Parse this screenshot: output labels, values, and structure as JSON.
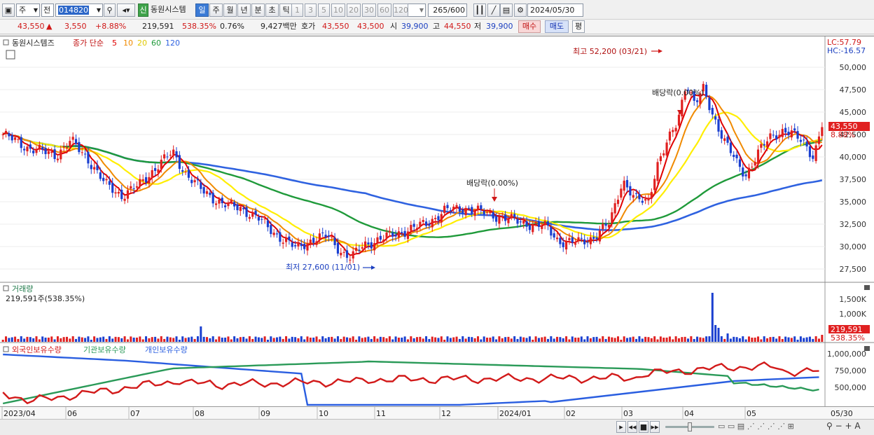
{
  "toolbar": {
    "type_label": "주",
    "prev_label": "전",
    "code": "014820",
    "badge": "신",
    "stock_name": "동원시스템",
    "periods": [
      "일",
      "주",
      "월",
      "년",
      "분",
      "초",
      "틱"
    ],
    "active_period": "일",
    "intervals": [
      "1",
      "3",
      "5",
      "10",
      "20",
      "30",
      "60",
      "120"
    ],
    "count": "265",
    "count_total": "/600",
    "date": "2024/05/30"
  },
  "quote": {
    "price": "43,550",
    "arrow": "▲",
    "change": "3,550",
    "change_pct": "+8.88%",
    "volume": "219,591",
    "volume_ratio": "538.35%",
    "turnover": "0.76%",
    "amount": "9,427백만",
    "ask_label": "호가",
    "ask": "43,550",
    "bid": "43,500",
    "open_label": "시",
    "open": "39,900",
    "high_label": "고",
    "high": "44,550",
    "low_label": "저",
    "low": "39,900",
    "buy_label": "매수",
    "sell_label": "매도",
    "eval_label": "평"
  },
  "price_panel": {
    "name_tag": "동원시스템즈",
    "legend_title": "종가 단순",
    "ma_labels": [
      "5",
      "10",
      "20",
      "60",
      "120"
    ],
    "lc": "LC:57.79",
    "hc": "HC:-16.57",
    "y_ticks": [
      "50,000",
      "47,500",
      "45,000",
      "42,500",
      "40,000",
      "37,500",
      "35,000",
      "32,500",
      "30,000",
      "27,500"
    ],
    "last_price": "43,550",
    "last_pct": "8.88%",
    "high_annot": "최고 52,200 (03/21)",
    "low_annot": "최저 27,600 (11/01)",
    "div_annot_1": "배당락(0.00%)",
    "div_annot_2": "배당락(0.00%)"
  },
  "volume_panel": {
    "title": "거래량",
    "subtitle": "219,591주(538.35%)",
    "y_ticks": [
      "1,500K",
      "1,000K",
      "500K"
    ],
    "last_value": "219,591",
    "last_pct": "538.35%"
  },
  "holding_panel": {
    "series": [
      "외국인보유수량",
      "기관보유수량",
      "개인보유수량"
    ],
    "y_ticks": [
      "1,000,000",
      "750,000",
      "500,000"
    ]
  },
  "x_axis": {
    "labels": [
      "2023/04",
      "06",
      "07",
      "08",
      "09",
      "10",
      "11",
      "12",
      "2024/01",
      "02",
      "03",
      "04",
      "05"
    ],
    "right_label": "05/30"
  },
  "colors": {
    "candle_up": "#e02020",
    "candle_down": "#1a3fd0",
    "ma5": "#e00000",
    "ma10": "#f08a00",
    "ma20": "#ffee00",
    "ma60": "#1f9a3a",
    "ma120": "#2f62e0",
    "foreign": "#d21a1a",
    "institution": "#2a9a58",
    "individual": "#2a5ee0"
  }
}
